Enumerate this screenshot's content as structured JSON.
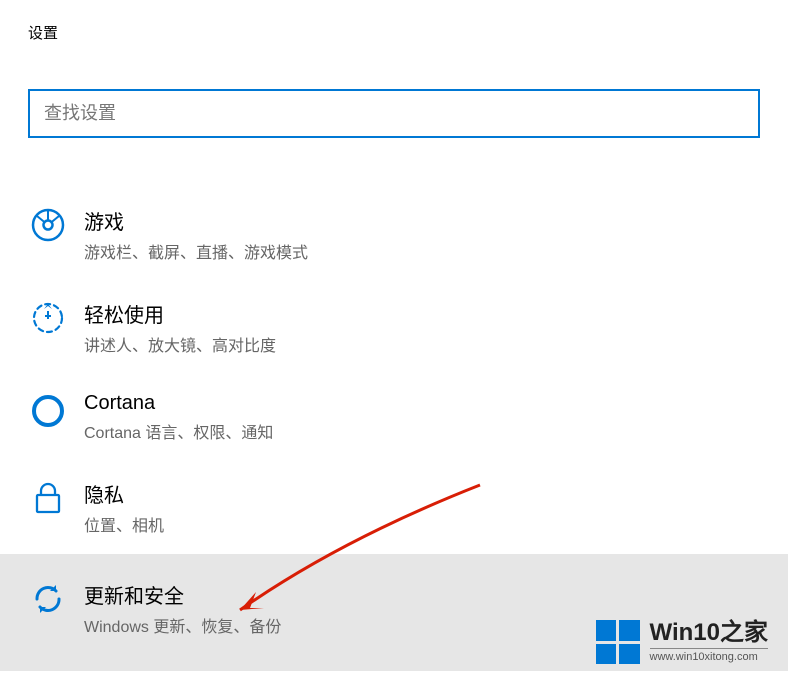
{
  "header": {
    "title": "设置"
  },
  "search": {
    "placeholder": "查找设置",
    "value": ""
  },
  "items": [
    {
      "title": "游戏",
      "subtitle": "游戏栏、截屏、直播、游戏模式"
    },
    {
      "title": "轻松使用",
      "subtitle": "讲述人、放大镜、高对比度"
    },
    {
      "title": "Cortana",
      "subtitle": "Cortana 语言、权限、通知"
    },
    {
      "title": "隐私",
      "subtitle": "位置、相机"
    },
    {
      "title": "更新和安全",
      "subtitle": "Windows 更新、恢复、备份"
    }
  ],
  "watermark": {
    "title": "Win10之家",
    "url": "www.win10xitong.com"
  },
  "colors": {
    "accent": "#0078d4",
    "arrow": "#d81e06"
  }
}
